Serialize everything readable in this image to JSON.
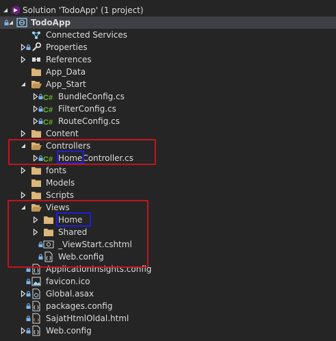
{
  "solution_explorer": {
    "solution": {
      "label": "Solution 'TodoApp' (1 project)",
      "expanded": true
    },
    "project": {
      "label": "TodoApp",
      "expanded": true
    },
    "items": [
      {
        "label": "Connected Services",
        "icon": "connected-services-icon"
      },
      {
        "label": "Properties",
        "icon": "wrench-icon"
      },
      {
        "label": "References",
        "icon": "references-icon"
      },
      {
        "label": "App_Data",
        "icon": "folder-icon"
      },
      {
        "label": "App_Start",
        "icon": "folder-open-icon"
      },
      {
        "label": "BundleConfig.cs",
        "icon": "csharp-file-icon"
      },
      {
        "label": "FilterConfig.cs",
        "icon": "csharp-file-icon"
      },
      {
        "label": "RouteConfig.cs",
        "icon": "csharp-file-icon"
      },
      {
        "label": "Content",
        "icon": "folder-icon"
      },
      {
        "label": "Controllers",
        "icon": "folder-open-icon"
      },
      {
        "label": "HomeController.cs",
        "icon": "csharp-file-icon"
      },
      {
        "label": "fonts",
        "icon": "folder-icon"
      },
      {
        "label": "Models",
        "icon": "folder-icon"
      },
      {
        "label": "Scripts",
        "icon": "folder-icon"
      },
      {
        "label": "Views",
        "icon": "folder-open-icon"
      },
      {
        "label": "Home",
        "icon": "folder-icon"
      },
      {
        "label": "Shared",
        "icon": "folder-icon"
      },
      {
        "label": "_ViewStart.cshtml",
        "icon": "razor-file-icon"
      },
      {
        "label": "Web.config",
        "icon": "config-file-icon"
      },
      {
        "label": "ApplicationInsights.config",
        "icon": "config-file-icon"
      },
      {
        "label": "favicon.ico",
        "icon": "image-file-icon"
      },
      {
        "label": "Global.asax",
        "icon": "asax-file-icon"
      },
      {
        "label": "packages.config",
        "icon": "config-file-icon"
      },
      {
        "label": "SajatHtmlOldal.html",
        "icon": "html-file-icon"
      },
      {
        "label": "Web.config",
        "icon": "config-file-icon"
      }
    ]
  },
  "annotations": {
    "red_boxes": [
      "Controllers",
      "Views"
    ],
    "blue_boxes": [
      "Home",
      "Home"
    ]
  },
  "colors": {
    "background": "#252526",
    "text": "#dcdcdc",
    "folder": "#dcb67a",
    "csharp": "#68b723",
    "lock": "#7ab4ea",
    "red_annotation": "#c4141c",
    "blue_annotation": "#1f1fd6"
  }
}
